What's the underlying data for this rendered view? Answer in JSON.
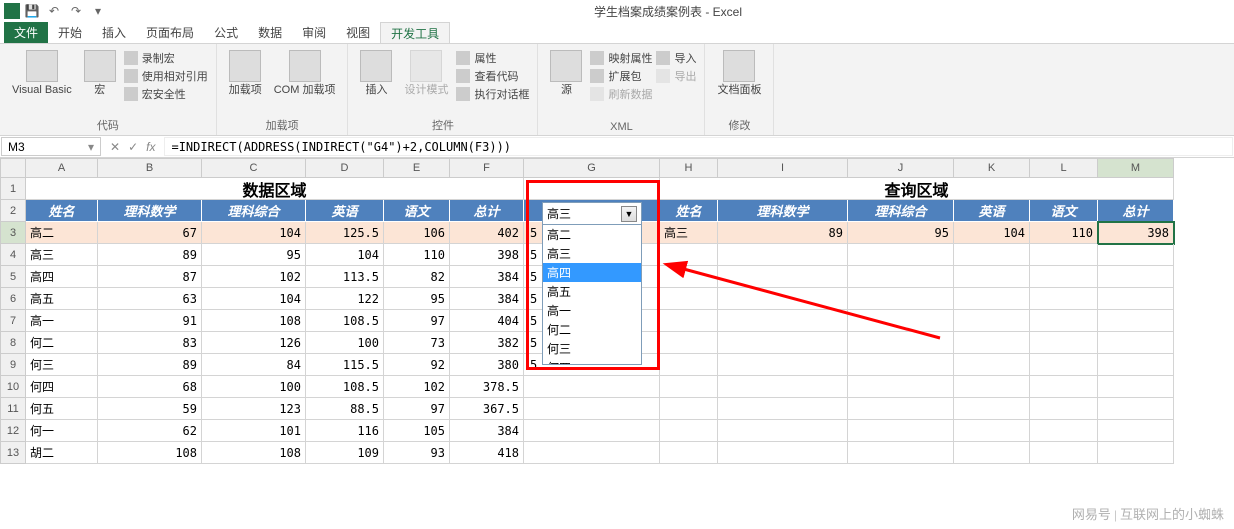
{
  "title": "学生档案成绩案例表 - Excel",
  "tabs": {
    "file": "文件",
    "start": "开始",
    "insert": "插入",
    "layout": "页面布局",
    "formula": "公式",
    "data": "数据",
    "review": "审阅",
    "view": "视图",
    "dev": "开发工具"
  },
  "ribbon": {
    "g1": {
      "vb": "Visual Basic",
      "macro": "宏",
      "rec": "录制宏",
      "rel": "使用相对引用",
      "sec": "宏安全性",
      "label": "代码"
    },
    "g2": {
      "addin": "加载项",
      "com": "COM 加载项",
      "label": "加载项"
    },
    "g3": {
      "insert": "插入",
      "design": "设计模式",
      "prop": "属性",
      "code": "查看代码",
      "dialog": "执行对话框",
      "label": "控件"
    },
    "g4": {
      "source": "源",
      "mapprop": "映射属性",
      "expand": "扩展包",
      "refresh": "刷新数据",
      "import": "导入",
      "export": "导出",
      "label": "XML"
    },
    "g5": {
      "panel": "文档面板",
      "label": "修改"
    }
  },
  "namebox": "M3",
  "formula": "=INDIRECT(ADDRESS(INDIRECT(\"G4\")+2,COLUMN(F3)))",
  "cols": [
    "A",
    "B",
    "C",
    "D",
    "E",
    "F",
    "G",
    "H",
    "I",
    "J",
    "K",
    "L",
    "M"
  ],
  "title_left": "数据区域",
  "title_right": "查询区域",
  "hdr_left": [
    "姓名",
    "理科数学",
    "理科综合",
    "英语",
    "语文",
    "总计"
  ],
  "hdr_right": [
    "姓名",
    "理科数学",
    "理科综合",
    "英语",
    "语文",
    "总计"
  ],
  "rows_left": [
    {
      "n": "3",
      "c": [
        "高二",
        "67",
        "104",
        "125.5",
        "106",
        "402"
      ],
      "g": "5"
    },
    {
      "n": "4",
      "c": [
        "高三",
        "89",
        "95",
        "104",
        "110",
        "398"
      ],
      "g": "5"
    },
    {
      "n": "5",
      "c": [
        "高四",
        "87",
        "102",
        "113.5",
        "82",
        "384"
      ],
      "g": "5"
    },
    {
      "n": "6",
      "c": [
        "高五",
        "63",
        "104",
        "122",
        "95",
        "384"
      ],
      "g": "5"
    },
    {
      "n": "7",
      "c": [
        "高一",
        "91",
        "108",
        "108.5",
        "97",
        "404"
      ],
      "g": "5"
    },
    {
      "n": "8",
      "c": [
        "何二",
        "83",
        "126",
        "100",
        "73",
        "382"
      ],
      "g": "5"
    },
    {
      "n": "9",
      "c": [
        "何三",
        "89",
        "84",
        "115.5",
        "92",
        "380"
      ],
      "g": "5"
    },
    {
      "n": "10",
      "c": [
        "何四",
        "68",
        "100",
        "108.5",
        "102",
        "378.5"
      ],
      "g": ""
    },
    {
      "n": "11",
      "c": [
        "何五",
        "59",
        "123",
        "88.5",
        "97",
        "367.5"
      ],
      "g": ""
    },
    {
      "n": "12",
      "c": [
        "何一",
        "62",
        "101",
        "116",
        "105",
        "384"
      ],
      "g": ""
    },
    {
      "n": "13",
      "c": [
        "胡二",
        "108",
        "108",
        "109",
        "93",
        "418"
      ],
      "g": ""
    }
  ],
  "result": {
    "name": "高三",
    "vals": [
      "89",
      "95",
      "104",
      "110",
      "398"
    ]
  },
  "dropdown": {
    "selected": "高三",
    "items": [
      "高二",
      "高三",
      "高四",
      "高五",
      "高一",
      "何二",
      "何三",
      "何四"
    ],
    "hl": 2
  },
  "watermark": "网易号 | 互联网上的小蜘蛛"
}
